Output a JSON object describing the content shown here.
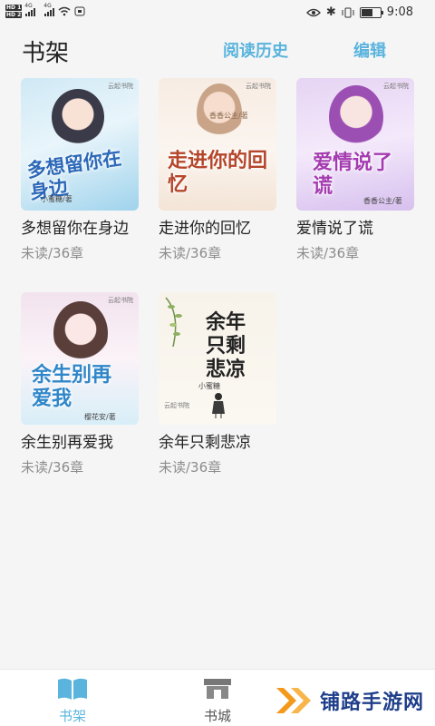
{
  "status_bar": {
    "time": "9:08",
    "net1": "4G",
    "net2": "4G",
    "hd1": "HD 1",
    "hd2": "HD 2"
  },
  "header": {
    "title": "书架",
    "history_label": "阅读历史",
    "edit_label": "编辑"
  },
  "books": [
    {
      "title": "多想留你在身边",
      "status": "未读/36章",
      "cover_title": "多想留你在身边",
      "cover_author": "小蜜糖/著",
      "publisher": "云起书院"
    },
    {
      "title": "走进你的回忆",
      "status": "未读/36章",
      "cover_title": "走进你的回忆",
      "cover_author": "香香公主/著",
      "publisher": "云起书院"
    },
    {
      "title": "爱情说了谎",
      "status": "未读/36章",
      "cover_title": "爱情说了谎",
      "cover_author": "香香公主/著",
      "publisher": "云起书院"
    },
    {
      "title": "余生别再爱我",
      "status": "未读/36章",
      "cover_title": "余生别再爱我",
      "cover_author": "樱花安/著",
      "publisher": "云起书院"
    },
    {
      "title": "余年只剩悲凉",
      "status": "未读/36章",
      "cover_title": "余年只剩悲凉",
      "cover_author": "小蜜糖",
      "publisher": "云起书院"
    }
  ],
  "bottom_nav": {
    "items": [
      {
        "label": "书架",
        "icon": "book-icon",
        "active": true
      },
      {
        "label": "书城",
        "icon": "store-icon",
        "active": false
      }
    ]
  },
  "watermark": {
    "text": "铺路手游网"
  },
  "colors": {
    "accent": "#5ab4dd",
    "active_nav": "#5ab4dd",
    "muted": "#8c8c8c",
    "watermark_orange": "#f39a1d"
  }
}
